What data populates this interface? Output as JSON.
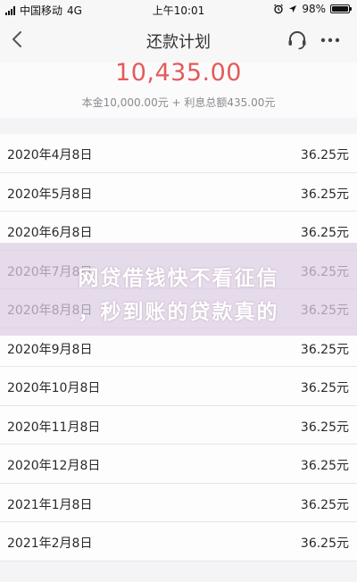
{
  "status_bar": {
    "carrier": "中国移动",
    "network": "4G",
    "time": "上午10:01",
    "battery": "98%",
    "battery_level": 0.98
  },
  "nav": {
    "title": "还款计划",
    "back_icon": "chevron-left-icon",
    "support_icon": "headset-icon",
    "more_icon": "more-dots-icon"
  },
  "summary": {
    "total": "10,435.00",
    "detail": "本金10,000.00元 + 利息总额435.00元",
    "total_color": "#e55a5a"
  },
  "schedule": [
    {
      "date": "2020年4月8日",
      "amount": "36.25元"
    },
    {
      "date": "2020年5月8日",
      "amount": "36.25元"
    },
    {
      "date": "2020年6月8日",
      "amount": "36.25元"
    },
    {
      "date": "2020年7月8日",
      "amount": "36.25元"
    },
    {
      "date": "2020年8月8日",
      "amount": "36.25元"
    },
    {
      "date": "2020年9月8日",
      "amount": "36.25元"
    },
    {
      "date": "2020年10月8日",
      "amount": "36.25元"
    },
    {
      "date": "2020年11月8日",
      "amount": "36.25元"
    },
    {
      "date": "2020年12月8日",
      "amount": "36.25元"
    },
    {
      "date": "2021年1月8日",
      "amount": "36.25元"
    },
    {
      "date": "2021年2月8日",
      "amount": "36.25元"
    }
  ],
  "overlay": {
    "line1": "网贷借钱快不看征信",
    "line2": "，秒到账的贷款真的"
  }
}
